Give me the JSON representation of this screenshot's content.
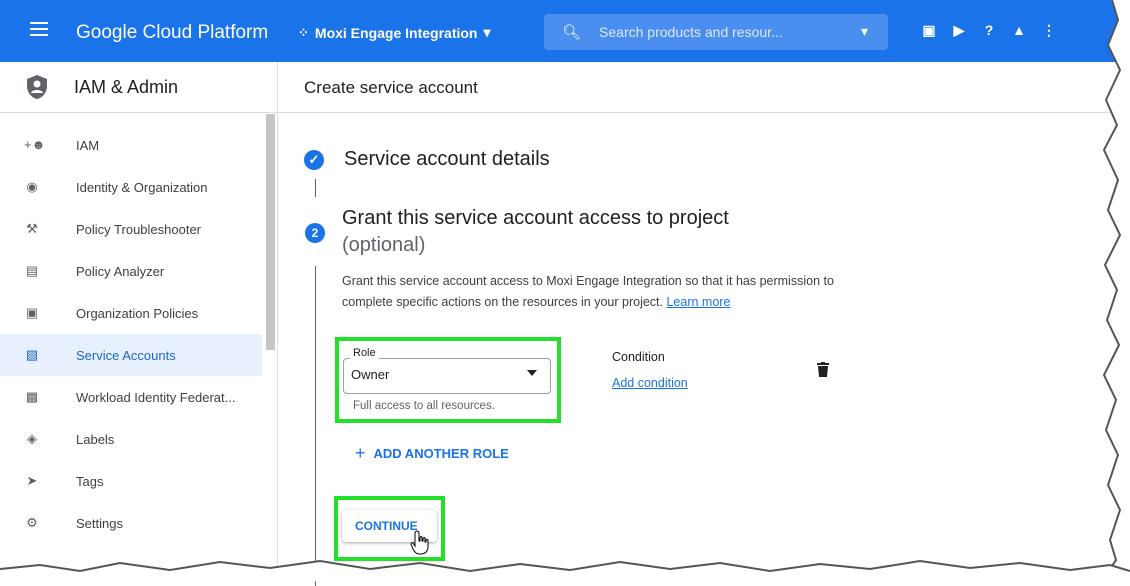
{
  "topbar": {
    "brand": "Google Cloud Platform",
    "project": "Moxi Engage Integration",
    "search_placeholder": "Search products and resour..."
  },
  "sidebar": {
    "title": "IAM & Admin",
    "items": [
      {
        "label": "IAM",
        "icon": "person-add-icon"
      },
      {
        "label": "Identity & Organization",
        "icon": "account-circle-icon"
      },
      {
        "label": "Policy Troubleshooter",
        "icon": "wrench-icon"
      },
      {
        "label": "Policy Analyzer",
        "icon": "document-search-icon"
      },
      {
        "label": "Organization Policies",
        "icon": "list-box-icon"
      },
      {
        "label": "Service Accounts",
        "icon": "service-account-icon",
        "active": true
      },
      {
        "label": "Workload Identity Federat...",
        "icon": "federation-icon"
      },
      {
        "label": "Labels",
        "icon": "label-icon"
      },
      {
        "label": "Tags",
        "icon": "tag-icon"
      },
      {
        "label": "Settings",
        "icon": "gear-icon"
      }
    ]
  },
  "main": {
    "header_title": "Create service account",
    "step1": {
      "title": "Service account details"
    },
    "step2": {
      "number": "2",
      "title": "Grant this service account access to project",
      "subtitle": "(optional)",
      "description": "Grant this service account access to Moxi Engage Integration so that it has permission to complete specific actions on the resources in your project.",
      "link": "Learn more"
    },
    "role": {
      "label": "Role",
      "value": "Owner",
      "help": "Full access to all resources."
    },
    "condition": {
      "label": "Condition",
      "link": "Add condition"
    },
    "add_role": "ADD ANOTHER ROLE",
    "continue": "CONTINUE"
  },
  "colors": {
    "brand_blue": "#1a73e8",
    "highlight_green": "#25e02b",
    "active_nav_bg": "#e8f0fe"
  }
}
